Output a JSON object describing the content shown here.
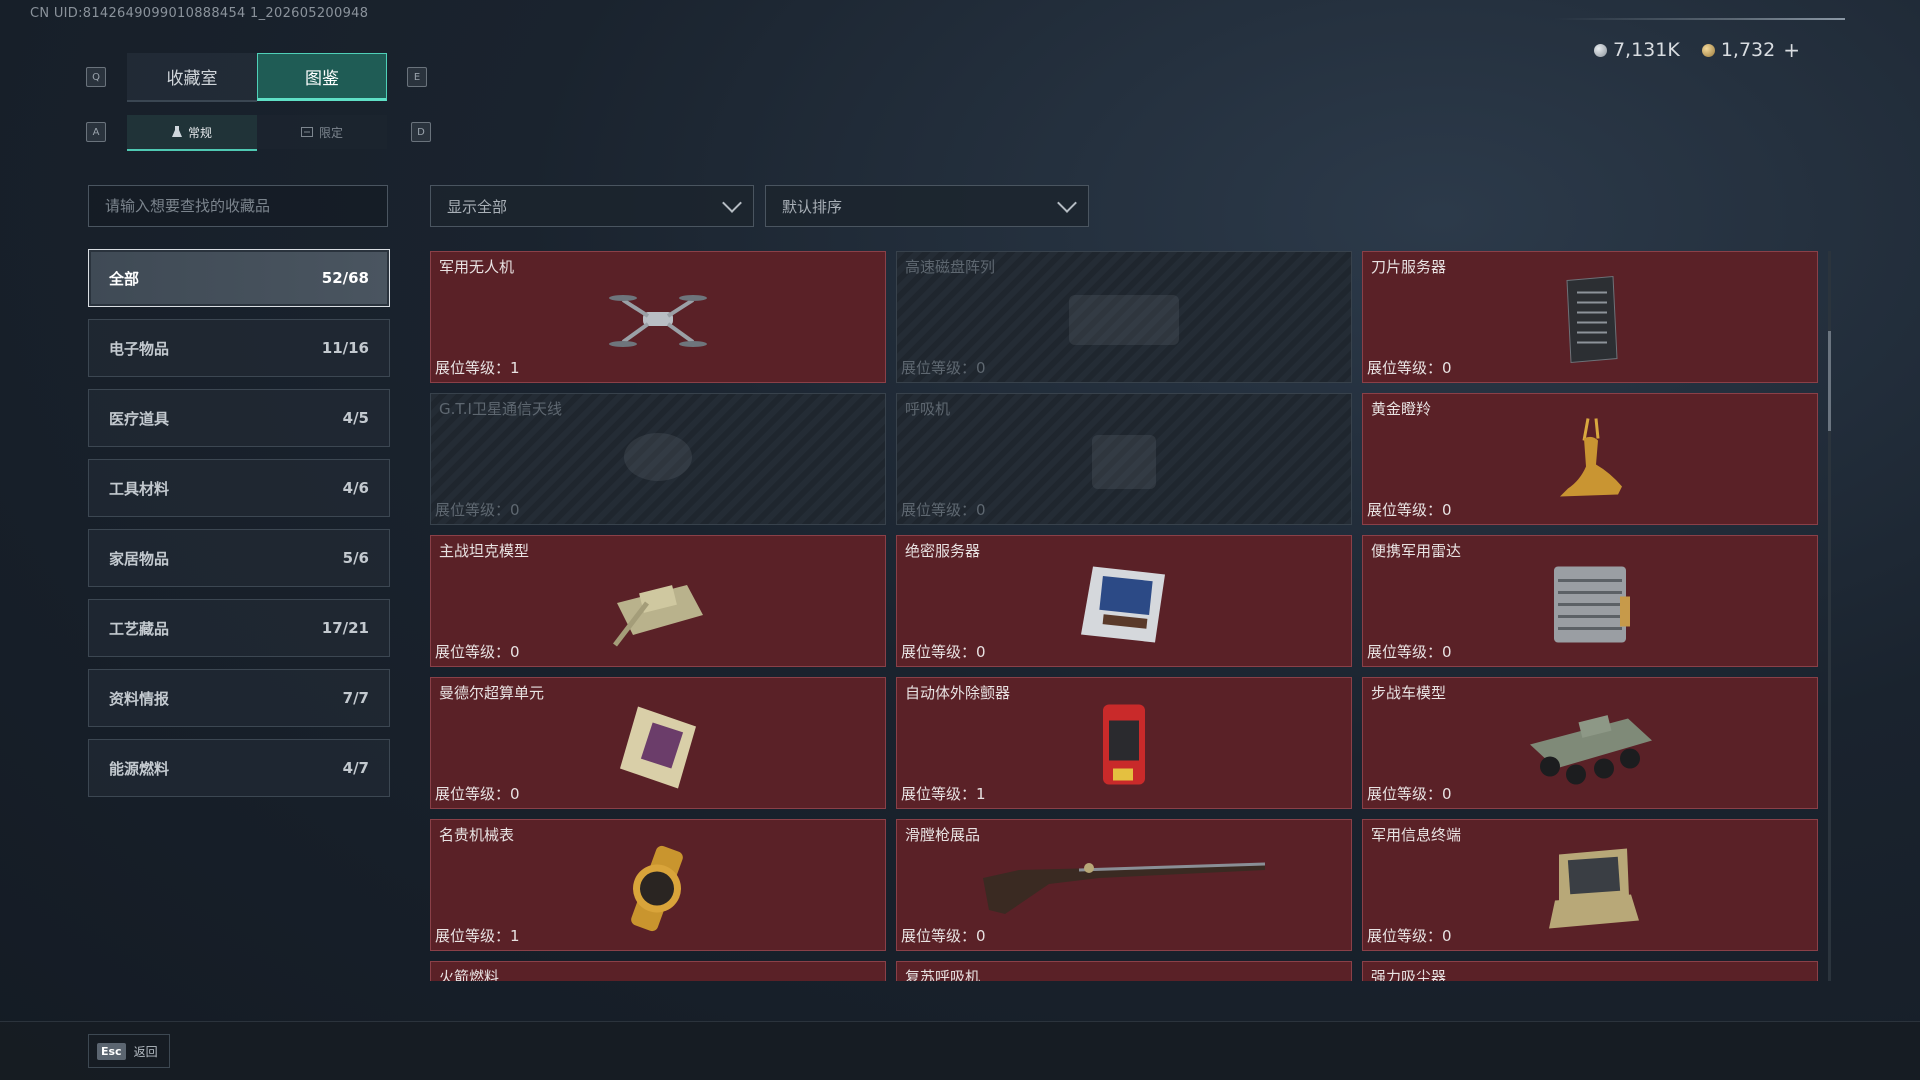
{
  "uid": "CN UID:8142649099010888454 1_202605200948",
  "currency": {
    "silver": "7,131K",
    "gold": "1,732",
    "add": "+"
  },
  "keys": {
    "q": "Q",
    "e": "E",
    "a": "A",
    "d": "D"
  },
  "main_tabs": [
    {
      "label": "收藏室"
    },
    {
      "label": "图鉴"
    }
  ],
  "sub_tabs": [
    {
      "label": "常规"
    },
    {
      "label": "限定"
    }
  ],
  "search": {
    "placeholder": "请输入想要查找的收藏品"
  },
  "filter": {
    "value": "显示全部"
  },
  "sort": {
    "value": "默认排序"
  },
  "categories": [
    {
      "label": "全部",
      "count": "52/68"
    },
    {
      "label": "电子物品",
      "count": "11/16"
    },
    {
      "label": "医疗道具",
      "count": "4/5"
    },
    {
      "label": "工具材料",
      "count": "4/6"
    },
    {
      "label": "家居物品",
      "count": "5/6"
    },
    {
      "label": "工艺藏品",
      "count": "17/21"
    },
    {
      "label": "资料情报",
      "count": "7/7"
    },
    {
      "label": "能源燃料",
      "count": "4/7"
    }
  ],
  "items": [
    {
      "name": "军用无人机",
      "level": "展位等级：1",
      "icon": "drone-icon"
    },
    {
      "name": "高速磁盘阵列",
      "level": "展位等级：0",
      "icon": "disk-array-icon"
    },
    {
      "name": "刀片服务器",
      "level": "展位等级：0",
      "icon": "blade-server-icon"
    },
    {
      "name": "G.T.I卫星通信天线",
      "level": "展位等级：0",
      "icon": "satellite-dish-icon"
    },
    {
      "name": "呼吸机",
      "level": "展位等级：0",
      "icon": "ventilator-icon"
    },
    {
      "name": "黄金瞪羚",
      "level": "展位等级：0",
      "icon": "gold-gazelle-icon"
    },
    {
      "name": "主战坦克模型",
      "level": "展位等级：0",
      "icon": "tank-model-icon"
    },
    {
      "name": "绝密服务器",
      "level": "展位等级：0",
      "icon": "secret-server-icon"
    },
    {
      "name": "便携军用雷达",
      "level": "展位等级：0",
      "icon": "portable-radar-icon"
    },
    {
      "name": "曼德尔超算单元",
      "level": "展位等级：0",
      "icon": "supercomputer-unit-icon"
    },
    {
      "name": "自动体外除颤器",
      "level": "展位等级：1",
      "icon": "defibrillator-icon"
    },
    {
      "name": "步战车模型",
      "level": "展位等级：0",
      "icon": "ifv-model-icon"
    },
    {
      "name": "名贵机械表",
      "level": "展位等级：1",
      "icon": "watch-icon"
    },
    {
      "name": "滑膛枪展品",
      "level": "展位等级：0",
      "icon": "musket-icon"
    },
    {
      "name": "军用信息终端",
      "level": "展位等级：0",
      "icon": "info-terminal-icon"
    },
    {
      "name": "火箭燃料",
      "level": "",
      "icon": "rocket-fuel-icon"
    },
    {
      "name": "复苏呼吸机",
      "level": "",
      "icon": "resuscitator-icon"
    },
    {
      "name": "强力吸尘器",
      "level": "",
      "icon": "vacuum-icon"
    }
  ],
  "footer": {
    "esc_key": "Esc",
    "esc_label": "返回"
  },
  "colors": {
    "accent": "#4fd0b8",
    "card_owned": "#5a2127",
    "card_locked": "#242c35"
  }
}
